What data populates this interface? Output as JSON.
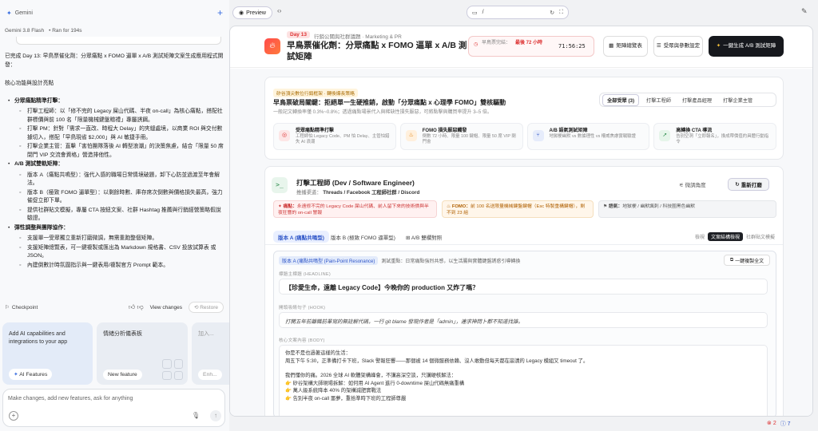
{
  "app": {
    "title": "Gemini",
    "model": "Gemini 3.8 Flash",
    "ran_for": "Ran for 194s"
  },
  "chat": {
    "intro": "已完成 Day 13: 早鳥票催化劑：分眾痛點 x FOMO 逼單 x A/B 測試矩陣文案生成應用程式開發：",
    "heading": "核心功能與設計亮點",
    "sections": [
      {
        "title": "分眾痛點精準打擊：",
        "items": [
          "打擊工程師：以「修不完的 Legacy 屎山代碼、半夜 on-call」為核心痛點，搭配社群標價與前 100 名「限量機械鍵盤贈禮」專屬誘餌。",
          "打擊 PM：針對「需求一直改、時程大 Delay」的夾縫處境，以商業 ROI 與交付數據切入，搭配「早鳥現省 $2,000」與 AI 敏捷手冊。",
          "打擊企業主管：直擊「害怕團隊落後 AI 轉型浪潮」的決策焦慮，結合「限量 50 席閉門 VIP 交流會資格」營造排他性。"
        ]
      },
      {
        "title": "A/B 測試雙軌矩陣：",
        "items": [
          "版本 A（痛點共鳴型）：強代入感的職場日常情境破題，卸下心防並過渡至年會解法。",
          "版本 B（極致 FOMO 逼單型）：以剩餘時數、庫存席次倒數與價格損失最高，強力催促立即下單。",
          "提供社群貼文模擬，專屬 CTA 按鈕文案、社群 Hashtag 推薦與行銷經營策略假說驗證。"
        ]
      },
      {
        "title": "彈性調整與團隊協作：",
        "items": [
          "支援單一受眾獨立重新打磨微調，無需重跑整個矩陣。",
          "支援矩陣總覽表，可一鍵複製或匯出為 Markdown 規格書、CSV 投放試算表 或 JSON。",
          "內建倒數計時氛圍指示與一鍵表用/複製官方 Prompt 範本。"
        ]
      }
    ],
    "checkpoint": "Checkpoint",
    "view_changes": "View changes",
    "restore": "Restore"
  },
  "suggestions": [
    {
      "text": "Add AI capabilities and integrations to your app",
      "button": "AI Features"
    },
    {
      "text": "情緒分析儀表板",
      "button": "New feature"
    },
    {
      "text": "加入...",
      "button": "Enh..."
    }
  ],
  "input": {
    "placeholder": "Make changes, add new features, ask for anything"
  },
  "topbar": {
    "preview_label": "Preview",
    "url": "/"
  },
  "page": {
    "day_badge": "Day 13",
    "category": "行銷公關與社群議題 · Marketing & PR",
    "title": "早鳥票催化劑：分眾痛點 x FOMO 逼單 x A/B 測試矩陣",
    "timer_label": "早鳥票完結：",
    "timer_note": "最後 72 小時",
    "timer_value": "71:56:25",
    "btn_matrix": "矩陣總覽表",
    "btn_params": "受眾與參數設定",
    "btn_generate": "一鍵生成 A/B 測試矩陣"
  },
  "strategy": {
    "badge": "矽谷頂尖數位行銷框架 · 轉換爆長策略",
    "title": "早鳥票破局關鍵：拒絕單一生硬推銷，啟動「分眾痛點 x 心理學 FOMO」雙核驅動",
    "subtitle": "一般記文轉換率僅 0.3%~0.8%；透過痛點場景代入與稀缺性損失厭惡，可將點擊與購買率提升 3–5 倍。",
    "filters": [
      "全部受眾 (3)",
      "打擊工程師",
      "打擊產品經理",
      "打擊企業主管"
    ],
    "features": [
      {
        "title": "受眾痛點精準打擊",
        "desc": "工程師怕 Legacy Code、PM 怕 Delay、主管怕錯失 AI 浪潮"
      },
      {
        "title": "FOMO 損失厭惡觸發",
        "desc": "倒數 72 小時、限量 100 鍵帽、限量 50 席 VIP 閉門會"
      },
      {
        "title": "A/B 語氣測試矩陣",
        "desc": "地獄梗幽默 vs 數據理性 vs 權威焦慮實戰驗證"
      },
      {
        "title": "高轉換 CTA 導流",
        "desc": "告別空洞「立即報名」，換成帶價值的具體行動指令"
      }
    ]
  },
  "role": {
    "title": "打擊工程師 (Dev / Software Engineer)",
    "channel_label": "推播渠道：",
    "channel": "Threads / Facebook 工程師社群 / Discord",
    "angle_btn": "微調角度",
    "regen_btn": "重新打磨",
    "pain_label": "痛點：",
    "pain": "永遠修不完的 Legacy Code 屎山代碼、前人留下來的技術債與半夜狂響的 on-call 警報",
    "fomo_label": "FOMO：",
    "fomo": "前 100 名送限量機械鍵盤鍵帽（Esc 特製重構鍵帽），剩不到 23 組",
    "tone_label": "語氣：",
    "tone": "地獄梗 / 幽默諷刺 / 科技圈黑色幽默",
    "tabs": [
      "版本 A (痛點共鳴型)",
      "版本 B (極致 FOMO 逼單型)",
      "A/B 雙欄對照"
    ],
    "view_label": "檢視",
    "view_on": "文案結構檢視",
    "view_off": "社群貼文模擬"
  },
  "variant": {
    "badge": "版本 A (痛點共鳴型 (Pain-Point Resonance)",
    "focus": "測試重點：日常痛點強烈共感，以生活腸與實體鍵盤誘惑引導轉換",
    "copy_btn": "一鍵複製全文",
    "headline_label": "標題主標題 (HEADLINE)",
    "headline": "【珍愛生命，遠離 Legacy Code】今晚你的 production 又炸了嗎？",
    "hook_label": "開頭吸睛句子 (HOOK)",
    "hook": "打開五年前離職前輩寫的無註解代碼，一行 git blame 發現作者是「admin」，連求神問卜都不知道找誰。",
    "body_label": "核心文案內容 (BODY)",
    "body_lines": [
      "你是不是也過著這樣的生活：",
      "周五下午 5:30，正準備打卡下班，Slack 警報狂響——那個被 14 個微服務依賴、沒人敢動但每天都在崩潰的 Legacy 模組又 timeout 了。",
      "",
      "我們懂你的痛。2026 全球 AI 軟體架構峰會，不講高深空談，只講硬核解法：",
      "👉 矽谷架構大師現場拆解：如何用 AI Agent 進行 0-downtime 屎山代碼無痛重構",
      "👉 萬人級系統降本 40% 的架構減肥實戰法",
      "👉 告別半夜 on-call 噩夢，重拾準時下班的工程師尊嚴"
    ]
  },
  "status": {
    "errors": "2",
    "infos": "7"
  },
  "colors": {
    "accent": "#2f56c8",
    "danger": "#dd3333",
    "brand_gradient": "#ff4b4b"
  }
}
